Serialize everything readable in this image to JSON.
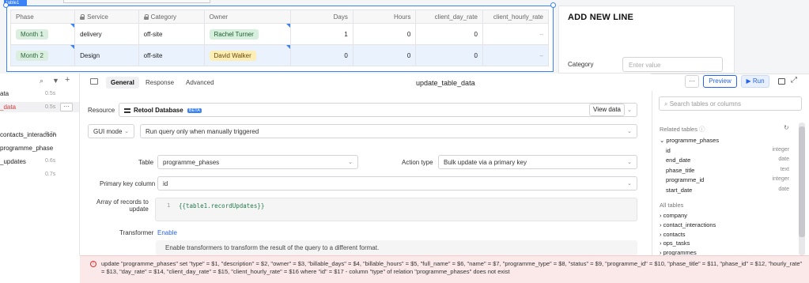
{
  "canvas": {
    "table_tag": "table1",
    "columns": [
      {
        "label": "Phase",
        "locked": false,
        "numeric": false
      },
      {
        "label": "Service",
        "locked": true,
        "numeric": false
      },
      {
        "label": "Category",
        "locked": true,
        "numeric": false
      },
      {
        "label": "Owner",
        "locked": false,
        "numeric": false
      },
      {
        "label": "Days",
        "locked": false,
        "numeric": true
      },
      {
        "label": "Hours",
        "locked": false,
        "numeric": true
      },
      {
        "label": "client_day_rate",
        "locked": false,
        "numeric": true
      },
      {
        "label": "client_hourly_rate",
        "locked": false,
        "numeric": true
      }
    ],
    "rows": [
      {
        "phase": "Month 1",
        "service": "delivery",
        "category": "off-site",
        "owner": "Rachel Turner",
        "owner_color": "green",
        "days": "1",
        "hours": "0",
        "client_day_rate": "0",
        "client_hourly_rate": "–",
        "selected": false
      },
      {
        "phase": "Month 2",
        "service": "Design",
        "category": "off-site",
        "owner": "David Walker",
        "owner_color": "yellow",
        "days": "0",
        "hours": "0",
        "client_day_rate": "0",
        "client_hourly_rate": "–",
        "selected": true
      }
    ],
    "add_new_line": {
      "title": "ADD NEW LINE",
      "category_label": "Category",
      "category_placeholder": "Enter value"
    }
  },
  "left_list": [
    {
      "name": "ata",
      "time": "0.5s",
      "active": false
    },
    {
      "name": "_data",
      "time": "0.5s",
      "active": true
    },
    {
      "name": "",
      "time": "0.7s",
      "active": false
    },
    {
      "name": "contacts_interaction",
      "time": "",
      "active": false
    },
    {
      "name": "programme_phase",
      "time": "0.6s",
      "active": false
    },
    {
      "name": "_updates",
      "time": "0.7s",
      "active": false
    }
  ],
  "editor": {
    "tabs": [
      "General",
      "Response",
      "Advanced"
    ],
    "active_tab": "General",
    "query_title": "update_table_data",
    "preview_label": "Preview",
    "run_label": "Run",
    "resource_label": "Resource",
    "resource_value": "Retool Database",
    "resource_badge": "BETA",
    "view_data_label": "View data",
    "mode_value": "GUI mode",
    "trigger_value": "Run query only when manually triggered",
    "table_label": "Table",
    "table_value": "programme_phases",
    "action_label": "Action type",
    "action_value": "Bulk update via a primary key",
    "pk_label": "Primary key column",
    "pk_value": "id",
    "records_label_1": "Array of records to",
    "records_label_2": "update",
    "code_line_no": "1",
    "code_value": "{{table1.recordUpdates}}",
    "transformer_label": "Transformer",
    "transformer_enable": "Enable",
    "transformer_hint": "Enable transformers to transform the result of the query to a different format."
  },
  "error": {
    "message": "update \"programme_phases\" set \"type\" = $1, \"description\" = $2, \"owner\" = $3, \"billable_days\" = $4, \"billable_hours\" = $5, \"full_name\" = $6, \"name\" = $7, \"programme_type\" = $8, \"status\" = $9, \"programme_id\" = $10, \"phase_title\" = $11, \"phase_id\" = $12, \"hourly_rate\" = $13, \"day_rate\" = $14, \"client_day_rate\" = $15, \"client_hourly_rate\" = $16 where \"id\" = $17 - column \"type\" of relation \"programme_phases\" does not exist",
    "icon": "!"
  },
  "schema": {
    "search_placeholder": "Search tables or columns",
    "related_title": "Related tables",
    "related_table": "programme_phases",
    "columns": [
      {
        "name": "id",
        "type": "integer"
      },
      {
        "name": "end_date",
        "type": "date"
      },
      {
        "name": "phase_title",
        "type": "text"
      },
      {
        "name": "programme_id",
        "type": "integer"
      },
      {
        "name": "start_date",
        "type": "date"
      }
    ],
    "all_title": "All tables",
    "all_tables": [
      "company",
      "contact_interactions",
      "contacts",
      "ops_tasks",
      "programmes"
    ]
  },
  "colors": {
    "accent": "#3b82f6",
    "selected_row": "#eaf2fd",
    "active_item": "#d33c3c",
    "error_bg": "#fbe9e9"
  }
}
